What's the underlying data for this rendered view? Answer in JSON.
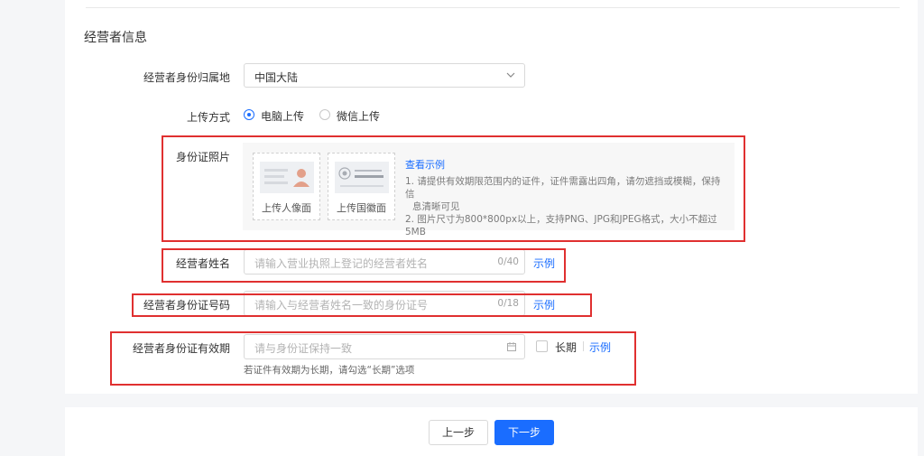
{
  "section": {
    "title": "经营者信息"
  },
  "region": {
    "label": "经营者身份归属地",
    "value": "中国大陆",
    "icon": "chevron-down-icon"
  },
  "upload_method": {
    "label": "上传方式",
    "options": [
      {
        "label": "电脑上传",
        "checked": true
      },
      {
        "label": "微信上传",
        "checked": false
      }
    ]
  },
  "id_photo": {
    "label": "身份证照片",
    "front_caption": "上传人像面",
    "back_caption": "上传国徽面",
    "example_link": "查看示例",
    "notes": [
      "1. 请提供有效期限范围内的证件，证件需露出四角，请勿遮挡或模糊，保持信",
      "息清晰可见",
      "2. 图片尺寸为800*800px以上，支持PNG、JPG和JPEG格式，大小不超过5MB"
    ]
  },
  "name": {
    "label": "经营者姓名",
    "placeholder": "请输入营业执照上登记的经营者姓名",
    "counter": "0/40",
    "example": "示例"
  },
  "id_number": {
    "label": "经营者身份证号码",
    "placeholder": "请输入与经营者姓名一致的身份证号",
    "counter": "0/18",
    "example": "示例"
  },
  "id_validity": {
    "label": "经营者身份证有效期",
    "placeholder": "请与身份证保持一致",
    "long_term_label": "长期",
    "example": "示例",
    "hint": "若证件有效期为长期，请勾选“长期”选项",
    "icon": "calendar-icon"
  },
  "footer": {
    "prev": "上一步",
    "next": "下一步"
  },
  "colors": {
    "accent": "#1a6dff",
    "highlight": "#e03030"
  }
}
